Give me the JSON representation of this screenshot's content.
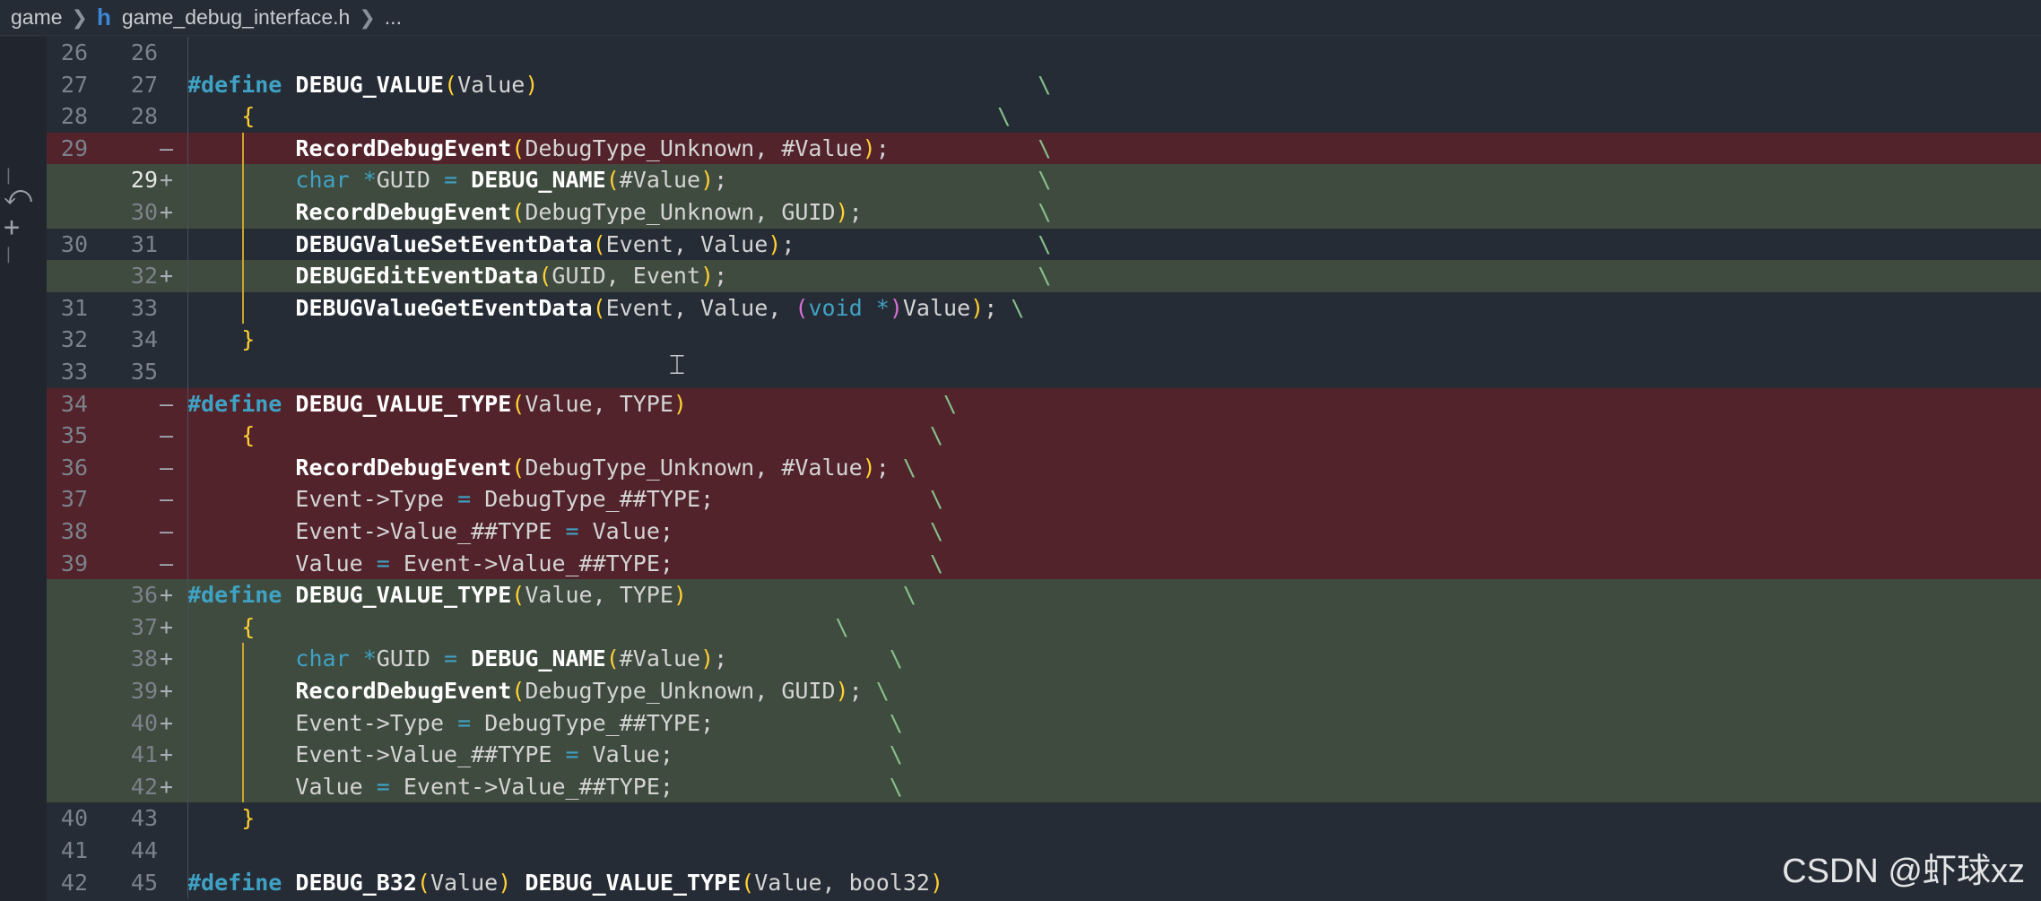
{
  "breadcrumb": {
    "folder": "game",
    "file_icon": "h",
    "file": "game_debug_interface.h",
    "more": "..."
  },
  "gutter_controls": [
    "revert-icon",
    "stage-add-icon"
  ],
  "lines": [
    {
      "old": "26",
      "new": "26",
      "mark": "",
      "type": "ctx",
      "code": ""
    },
    {
      "old": "27",
      "new": "27",
      "mark": "",
      "type": "ctx",
      "code": "#define DEBUG_VALUE(Value)                                     \\"
    },
    {
      "old": "28",
      "new": "28",
      "mark": "",
      "type": "ctx",
      "code": "    {                                                       \\"
    },
    {
      "old": "29",
      "new": "",
      "mark": "—",
      "type": "del",
      "code": "        RecordDebugEvent(DebugType_Unknown, #Value);           \\"
    },
    {
      "old": "",
      "new": "29",
      "mark": "+",
      "type": "add",
      "code": "        char *GUID = DEBUG_NAME(#Value);                       \\"
    },
    {
      "old": "",
      "new": "30",
      "mark": "+",
      "type": "add",
      "code": "        RecordDebugEvent(DebugType_Unknown, GUID);             \\"
    },
    {
      "old": "30",
      "new": "31",
      "mark": "",
      "type": "ctx",
      "code": "        DEBUGValueSetEventData(Event, Value);                  \\"
    },
    {
      "old": "",
      "new": "32",
      "mark": "+",
      "type": "add",
      "code": "        DEBUGEditEventData(GUID, Event);                       \\"
    },
    {
      "old": "31",
      "new": "33",
      "mark": "",
      "type": "ctx",
      "code": "        DEBUGValueGetEventData(Event, Value, (void *)Value); \\"
    },
    {
      "old": "32",
      "new": "34",
      "mark": "",
      "type": "ctx",
      "code": "    }"
    },
    {
      "old": "33",
      "new": "35",
      "mark": "",
      "type": "ctx",
      "code": ""
    },
    {
      "old": "34",
      "new": "",
      "mark": "—",
      "type": "del",
      "code": "#define DEBUG_VALUE_TYPE(Value, TYPE)                   \\"
    },
    {
      "old": "35",
      "new": "",
      "mark": "—",
      "type": "del",
      "code": "    {                                                  \\"
    },
    {
      "old": "36",
      "new": "",
      "mark": "—",
      "type": "del",
      "code": "        RecordDebugEvent(DebugType_Unknown, #Value); \\"
    },
    {
      "old": "37",
      "new": "",
      "mark": "—",
      "type": "del",
      "code": "        Event->Type = DebugType_##TYPE;                \\"
    },
    {
      "old": "38",
      "new": "",
      "mark": "—",
      "type": "del",
      "code": "        Event->Value_##TYPE = Value;                   \\"
    },
    {
      "old": "39",
      "new": "",
      "mark": "—",
      "type": "del",
      "code": "        Value = Event->Value_##TYPE;                   \\"
    },
    {
      "old": "",
      "new": "36",
      "mark": "+",
      "type": "add",
      "code": "#define DEBUG_VALUE_TYPE(Value, TYPE)                \\"
    },
    {
      "old": "",
      "new": "37",
      "mark": "+",
      "type": "add",
      "code": "    {                                           \\"
    },
    {
      "old": "",
      "new": "38",
      "mark": "+",
      "type": "add",
      "code": "        char *GUID = DEBUG_NAME(#Value);            \\"
    },
    {
      "old": "",
      "new": "39",
      "mark": "+",
      "type": "add",
      "code": "        RecordDebugEvent(DebugType_Unknown, GUID); \\"
    },
    {
      "old": "",
      "new": "40",
      "mark": "+",
      "type": "add",
      "code": "        Event->Type = DebugType_##TYPE;             \\"
    },
    {
      "old": "",
      "new": "41",
      "mark": "+",
      "type": "add",
      "code": "        Event->Value_##TYPE = Value;                \\"
    },
    {
      "old": "",
      "new": "42",
      "mark": "+",
      "type": "add",
      "code": "        Value = Event->Value_##TYPE;                \\"
    },
    {
      "old": "40",
      "new": "43",
      "mark": "",
      "type": "ctx",
      "code": "    }"
    },
    {
      "old": "41",
      "new": "44",
      "mark": "",
      "type": "ctx",
      "code": ""
    },
    {
      "old": "42",
      "new": "45",
      "mark": "",
      "type": "ctx",
      "code": "#define DEBUG_B32(Value) DEBUG_VALUE_TYPE(Value, bool32)"
    }
  ],
  "active_line_number": "29",
  "watermark": "CSDN @虾球xz",
  "colors": {
    "background": "#262c35",
    "deleted_line": "#52232b",
    "added_line": "#3f4b3e",
    "added_highlight": "#1c5130",
    "keyword": "#3fa2c4",
    "paren_level1": "#ffd033",
    "paren_level2": "#d970d6",
    "indent_guide": "#c9a52c"
  }
}
